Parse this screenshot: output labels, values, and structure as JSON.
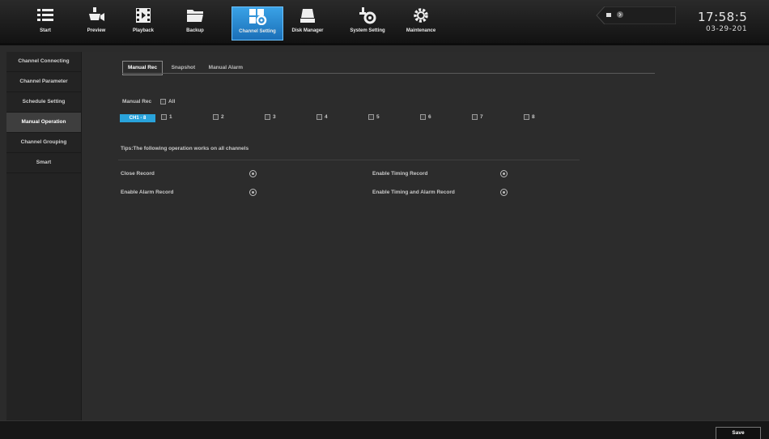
{
  "nav": {
    "items": [
      {
        "label": "Start",
        "icon": "menu-icon"
      },
      {
        "label": "Preview",
        "icon": "camera-icon"
      },
      {
        "label": "Playback",
        "icon": "film-icon"
      },
      {
        "label": "Backup",
        "icon": "folder-icon"
      },
      {
        "label": "Channel Setting",
        "icon": "channel-settings-icon",
        "active": true
      },
      {
        "label": "Disk Manager",
        "icon": "hard-disk-icon"
      },
      {
        "label": "System Setting",
        "icon": "system-settings-icon"
      },
      {
        "label": "Maintenance",
        "icon": "wrench-gear-icon"
      }
    ],
    "active_color": "#2b8fd9"
  },
  "clock": {
    "time": "17:58:5",
    "date": "03-29-201"
  },
  "sidebar": {
    "items": [
      {
        "label": "Channel Connecting"
      },
      {
        "label": "Channel Parameter"
      },
      {
        "label": "Schedule Setting"
      },
      {
        "label": "Manual Operation",
        "active": true
      },
      {
        "label": "Channel Grouping"
      },
      {
        "label": "Smart"
      }
    ]
  },
  "tabs": {
    "manual_rec": "Manual Rec",
    "snapshot": "Snapshot",
    "manual_alarm": "Manual Alarm"
  },
  "manual_rec": {
    "label": "Manual Rec",
    "all_label": "All",
    "channel_group_button": "CH1 - 8",
    "channels": [
      "1",
      "2",
      "3",
      "4",
      "5",
      "6",
      "7",
      "8"
    ]
  },
  "tips": "Tips:The following operation works on all channels",
  "operations": {
    "close_record": "Close Record",
    "enable_alarm_record": "Enable Alarm Record",
    "enable_timing_record": "Enable Timing Record",
    "enable_timing_alarm_record": "Enable Timing and Alarm Record"
  },
  "footer": {
    "save": "Save"
  }
}
